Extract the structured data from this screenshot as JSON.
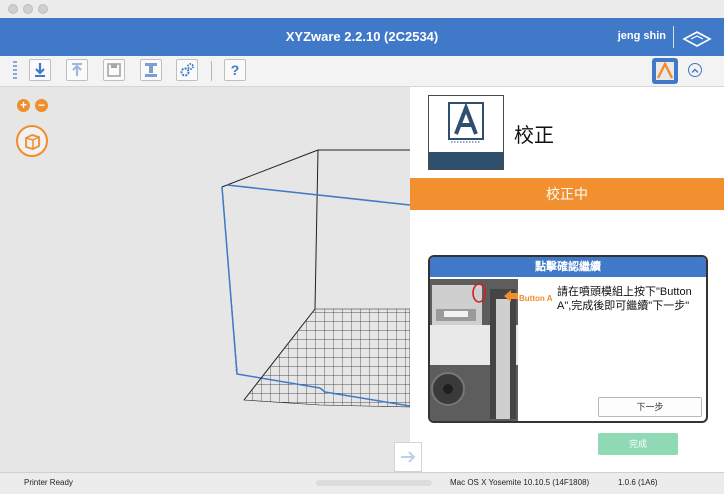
{
  "window": {
    "title": "XYZware 2.2.10 (2C2534)",
    "user": "jeng shin"
  },
  "toolbar": {
    "help_label": "?"
  },
  "viewport": {
    "zoom_in_label": "+",
    "zoom_out_label": "−"
  },
  "panel": {
    "title": "校正",
    "status_banner": "校正中",
    "dialog": {
      "header": "點擊確認繼續",
      "button_a_label": "Button A",
      "instruction": "請在噴頭模組上按下\"Button A\",完成後即可繼續\"下一步\"",
      "next_label": "下一步"
    },
    "done_label": "完成"
  },
  "status": {
    "left": "Printer Ready",
    "os": "Mac OS X Yosemite 10.10.5 (14F1808)",
    "version": "1.0.6 (1A6)"
  },
  "colors": {
    "accent_blue": "#3f79c8",
    "accent_orange": "#f29030",
    "done_green": "#8fd9b5"
  }
}
